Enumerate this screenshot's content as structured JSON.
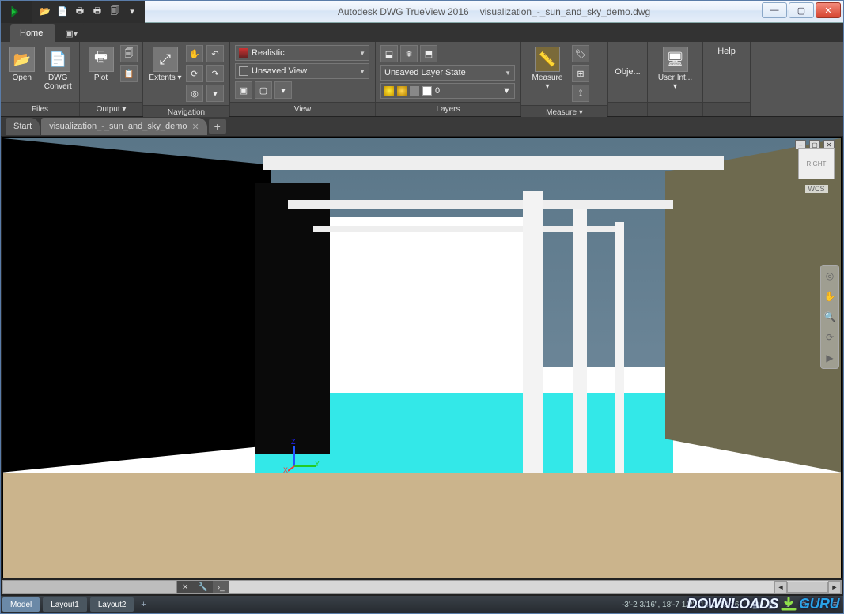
{
  "window": {
    "app_title": "Autodesk DWG TrueView 2016",
    "file_title": "visualization_-_sun_and_sky_demo.dwg"
  },
  "tabs": {
    "home": "Home",
    "extra": "▾"
  },
  "ribbon": {
    "files": {
      "title": "Files",
      "open": "Open",
      "convert": "DWG\nConvert"
    },
    "output": {
      "title": "Output",
      "plot": "Plot"
    },
    "nav": {
      "title": "Navigation",
      "extents": "Extents"
    },
    "view": {
      "title": "View",
      "visual_style": "Realistic",
      "named_view": "Unsaved View"
    },
    "layers": {
      "title": "Layers",
      "state": "Unsaved Layer State",
      "current": "0"
    },
    "measure": {
      "title": "Measure",
      "measure": "Measure"
    },
    "obj": {
      "label": "Obje..."
    },
    "ui": {
      "label": "User Int..."
    },
    "help": {
      "label": "Help"
    }
  },
  "filetabs": {
    "start": "Start",
    "doc": "visualization_-_sun_and_sky_demo"
  },
  "viewport": {
    "cube_face": "RIGHT",
    "wcs": "WCS",
    "axis_z": "Z",
    "axis_y": "Y",
    "axis_x": "X"
  },
  "status": {
    "model": "Model",
    "layout1": "Layout1",
    "layout2": "Layout2",
    "coords": "-3'-2 3/16\", 18'-7 1/2\", 18'-2 13/16\""
  },
  "watermark": {
    "downloads": "DOWNLOADS",
    "guru": "GURU"
  }
}
